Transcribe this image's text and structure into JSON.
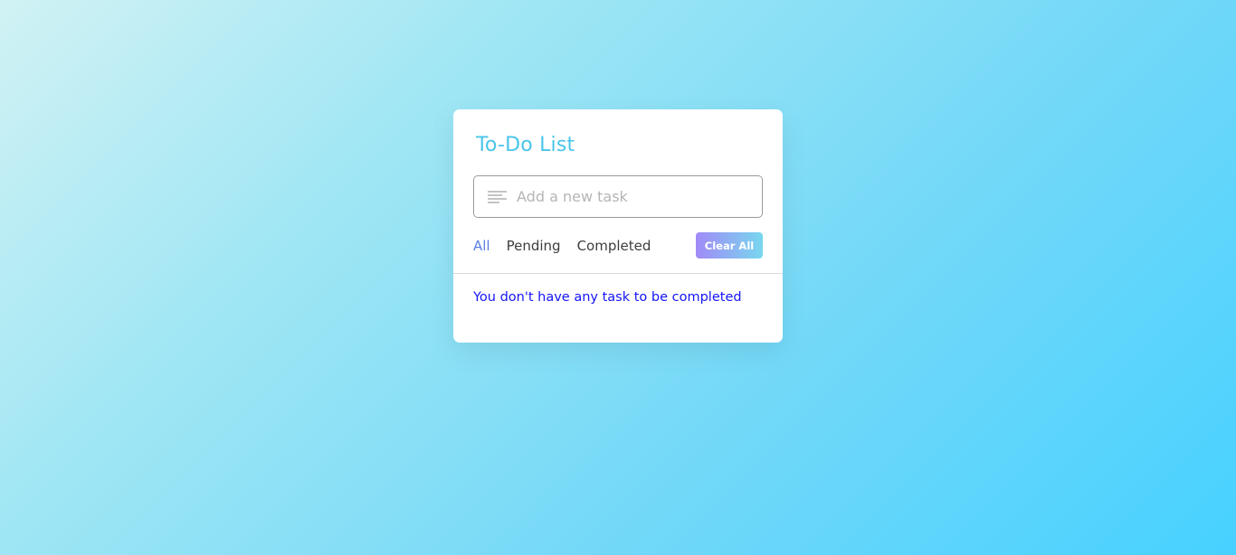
{
  "app": {
    "title": "To-Do List"
  },
  "input": {
    "placeholder": "Add a new task",
    "value": "",
    "icon": "lines-icon"
  },
  "filters": {
    "items": [
      {
        "label": "All",
        "active": true
      },
      {
        "label": "Pending",
        "active": false
      },
      {
        "label": "Completed",
        "active": false
      }
    ]
  },
  "actions": {
    "clear_label": "Clear All"
  },
  "tasks": {
    "items": [],
    "empty_message": "You don't have any task to be completed"
  },
  "colors": {
    "title": "#4bc5ea",
    "active_filter": "#5a7fe0",
    "empty_message": "#1515f5",
    "button_gradient_start": "#a18af7",
    "button_gradient_end": "#78d7ee"
  }
}
